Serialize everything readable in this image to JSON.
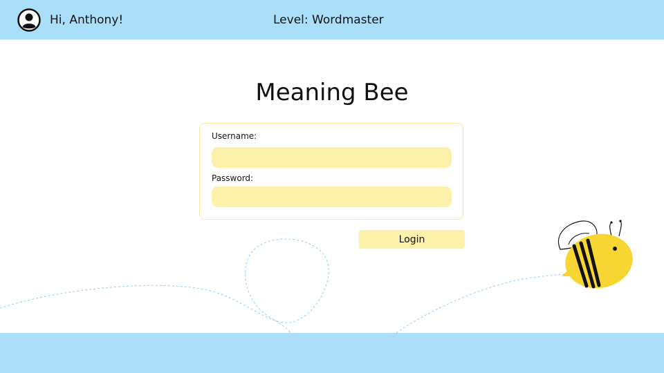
{
  "header": {
    "greeting": "Hi, Anthony!",
    "level": "Level: Wordmaster",
    "avatar_icon": "user-circle-icon"
  },
  "main": {
    "title": "Meaning Bee",
    "username_label": "Username:",
    "username_value": "",
    "password_label": "Password:",
    "password_value": "",
    "login_label": "Login",
    "mascot_icon": "bee-icon"
  },
  "colors": {
    "header_bg": "#abdff9",
    "footer_bg": "#abdff9",
    "input_bg": "#fbf1a9",
    "card_border": "#f6e79a",
    "bee_yellow": "#f7d634",
    "flight_path": "#8ecff0"
  }
}
